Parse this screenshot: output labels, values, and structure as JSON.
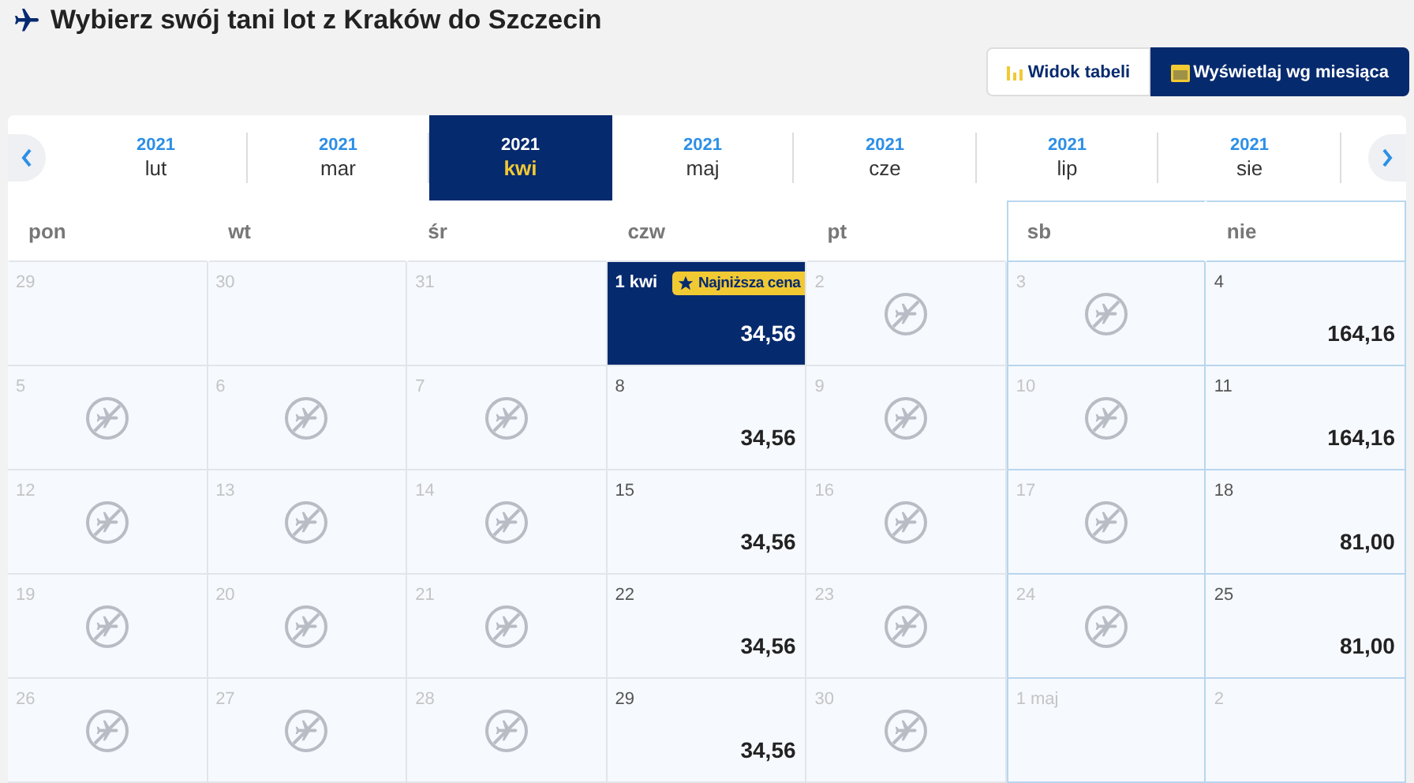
{
  "header": {
    "title": "Wybierz swój tani lot z Kraków do Szczecin"
  },
  "view_buttons": [
    {
      "label": "Widok tabeli",
      "selected": false
    },
    {
      "label": "Wyświetlaj wg miesiąca",
      "selected": true
    }
  ],
  "months": [
    {
      "year": "2021",
      "month": "lut",
      "selected": false
    },
    {
      "year": "2021",
      "month": "mar",
      "selected": false
    },
    {
      "year": "2021",
      "month": "kwi",
      "selected": true
    },
    {
      "year": "2021",
      "month": "maj",
      "selected": false
    },
    {
      "year": "2021",
      "month": "cze",
      "selected": false
    },
    {
      "year": "2021",
      "month": "lip",
      "selected": false
    },
    {
      "year": "2021",
      "month": "sie",
      "selected": false
    }
  ],
  "weekdays": [
    {
      "label": "pon",
      "weekend": false
    },
    {
      "label": "wt",
      "weekend": false
    },
    {
      "label": "śr",
      "weekend": false
    },
    {
      "label": "czw",
      "weekend": false
    },
    {
      "label": "pt",
      "weekend": false
    },
    {
      "label": "sb",
      "weekend": true
    },
    {
      "label": "nie",
      "weekend": true
    }
  ],
  "weeks": [
    [
      {
        "day": "29",
        "kind": "empty",
        "selected": false
      },
      {
        "day": "30",
        "kind": "empty",
        "selected": false
      },
      {
        "day": "31",
        "kind": "empty",
        "selected": false
      },
      {
        "day": "1 kwi",
        "kind": "price",
        "price": "34,56",
        "badge": "Najniższa cena",
        "selected": true
      },
      {
        "day": "2",
        "kind": "noflight",
        "selected": false
      },
      {
        "day": "3",
        "kind": "noflight",
        "selected": false
      },
      {
        "day": "4",
        "kind": "price",
        "price": "164,16",
        "selected": false
      }
    ],
    [
      {
        "day": "5",
        "kind": "noflight",
        "selected": false
      },
      {
        "day": "6",
        "kind": "noflight",
        "selected": false
      },
      {
        "day": "7",
        "kind": "noflight",
        "selected": false
      },
      {
        "day": "8",
        "kind": "price",
        "price": "34,56",
        "selected": false
      },
      {
        "day": "9",
        "kind": "noflight",
        "selected": false
      },
      {
        "day": "10",
        "kind": "noflight",
        "selected": false
      },
      {
        "day": "11",
        "kind": "price",
        "price": "164,16",
        "selected": false
      }
    ],
    [
      {
        "day": "12",
        "kind": "noflight",
        "selected": false
      },
      {
        "day": "13",
        "kind": "noflight",
        "selected": false
      },
      {
        "day": "14",
        "kind": "noflight",
        "selected": false
      },
      {
        "day": "15",
        "kind": "price",
        "price": "34,56",
        "selected": false
      },
      {
        "day": "16",
        "kind": "noflight",
        "selected": false
      },
      {
        "day": "17",
        "kind": "noflight",
        "selected": false
      },
      {
        "day": "18",
        "kind": "price",
        "price": "81,00",
        "selected": false
      }
    ],
    [
      {
        "day": "19",
        "kind": "noflight",
        "selected": false
      },
      {
        "day": "20",
        "kind": "noflight",
        "selected": false
      },
      {
        "day": "21",
        "kind": "noflight",
        "selected": false
      },
      {
        "day": "22",
        "kind": "price",
        "price": "34,56",
        "selected": false
      },
      {
        "day": "23",
        "kind": "noflight",
        "selected": false
      },
      {
        "day": "24",
        "kind": "noflight",
        "selected": false
      },
      {
        "day": "25",
        "kind": "price",
        "price": "81,00",
        "selected": false
      }
    ],
    [
      {
        "day": "26",
        "kind": "noflight",
        "selected": false
      },
      {
        "day": "27",
        "kind": "noflight",
        "selected": false
      },
      {
        "day": "28",
        "kind": "noflight",
        "selected": false
      },
      {
        "day": "29",
        "kind": "price",
        "price": "34,56",
        "selected": false
      },
      {
        "day": "30",
        "kind": "noflight",
        "selected": false
      },
      {
        "day": "1 maj",
        "kind": "empty",
        "selected": false
      },
      {
        "day": "2",
        "kind": "empty",
        "selected": false
      }
    ]
  ]
}
